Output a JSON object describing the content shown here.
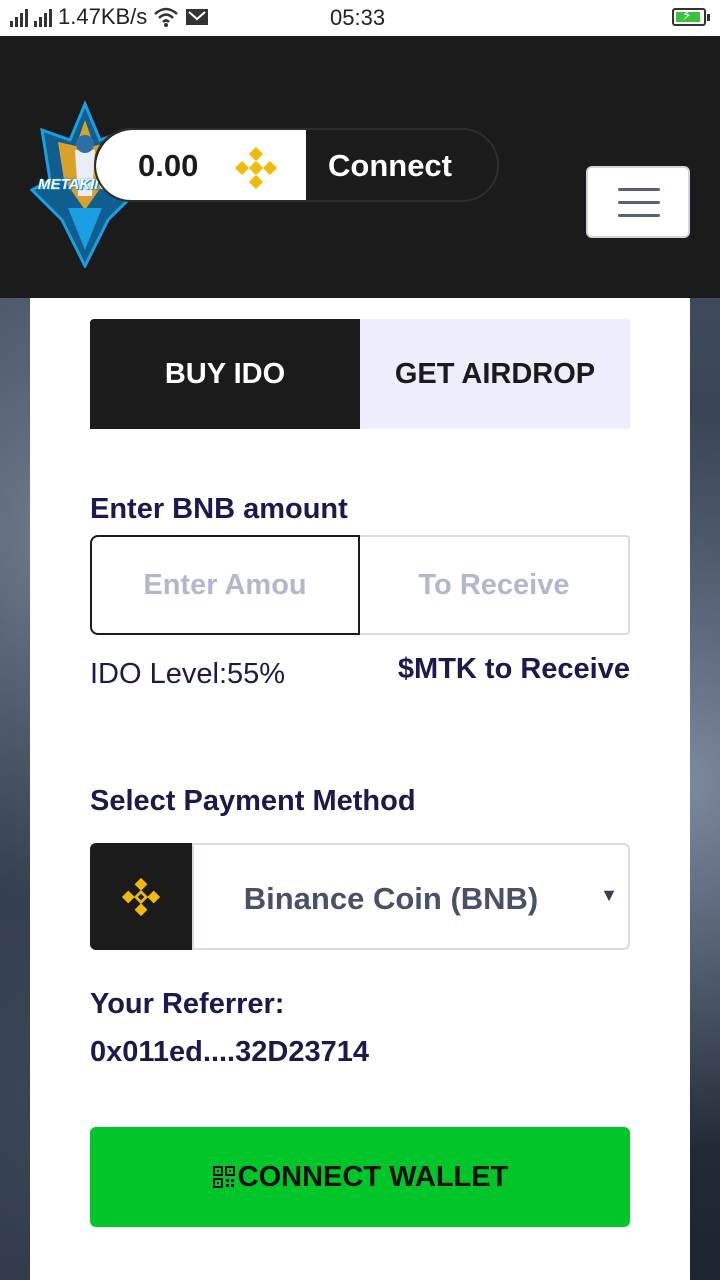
{
  "status_bar": {
    "network_speed": "1.47KB/s",
    "time": "05:33"
  },
  "header": {
    "logo_text": "METAKINGS",
    "wallet_balance": "0.00",
    "connect_label": "Connect",
    "icons": [
      "bnb-icon",
      "menu-icon"
    ]
  },
  "tabs": [
    {
      "label": "BUY IDO",
      "active": true
    },
    {
      "label": "GET AIRDROP",
      "active": false
    }
  ],
  "buy_form": {
    "amount_label": "Enter BNB amount",
    "amount_placeholder": "Enter Amou",
    "receive_placeholder": "To Receive",
    "ido_level": "IDO Level:55%",
    "receive_label": "$MTK to Receive",
    "payment_label": "Select Payment Method",
    "payment_selected": "Binance Coin (BNB)",
    "referrer_label": "Your Referrer:",
    "referrer_address": "0x011ed....32D23714",
    "connect_wallet_label": "CONNECT WALLET"
  },
  "colors": {
    "header_bg": "#1b1b1c",
    "bnb_yellow": "#f0b90b",
    "accent_text": "#1a1a4e",
    "connect_green": "#00c62a",
    "tab_inactive_bg": "#ededfb"
  }
}
